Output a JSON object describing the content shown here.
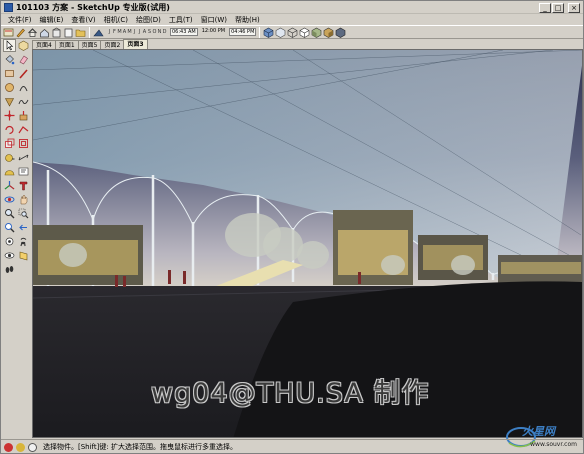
{
  "window": {
    "title": "101103 方案 - SketchUp 专业版(试用)"
  },
  "menu": [
    "文件(F)",
    "编辑(E)",
    "查看(V)",
    "相机(C)",
    "绘图(D)",
    "工具(T)",
    "窗口(W)",
    "帮助(H)"
  ],
  "toolbar": {
    "months": [
      "J",
      "F",
      "M",
      "A",
      "M",
      "J",
      "J",
      "A",
      "S",
      "O",
      "N",
      "D"
    ],
    "time_start": "06:43 AM",
    "time_mid": "12:00 PM",
    "time_end": "04:46 PM"
  },
  "tabs": [
    "页面4",
    "页面1",
    "页面5",
    "页面2",
    "页面3"
  ],
  "active_tab": "页面3",
  "viewport": {
    "watermark": "wg04@THU.SA 制作"
  },
  "logo": {
    "brand": "火星网",
    "url": "www.souvr.com"
  },
  "statusbar": {
    "text": "选择物件。[Shift]键: 扩大选择范围。拖曳鼠标进行多重选择。"
  },
  "colors": {
    "chrome": "#d4d0c8",
    "sky_top": "#2f3350",
    "sky_bottom": "#c9c6c8",
    "ground": "#1e1e22",
    "canopy": "#9fb4c2",
    "accent_blue": "#3d7fc4"
  }
}
